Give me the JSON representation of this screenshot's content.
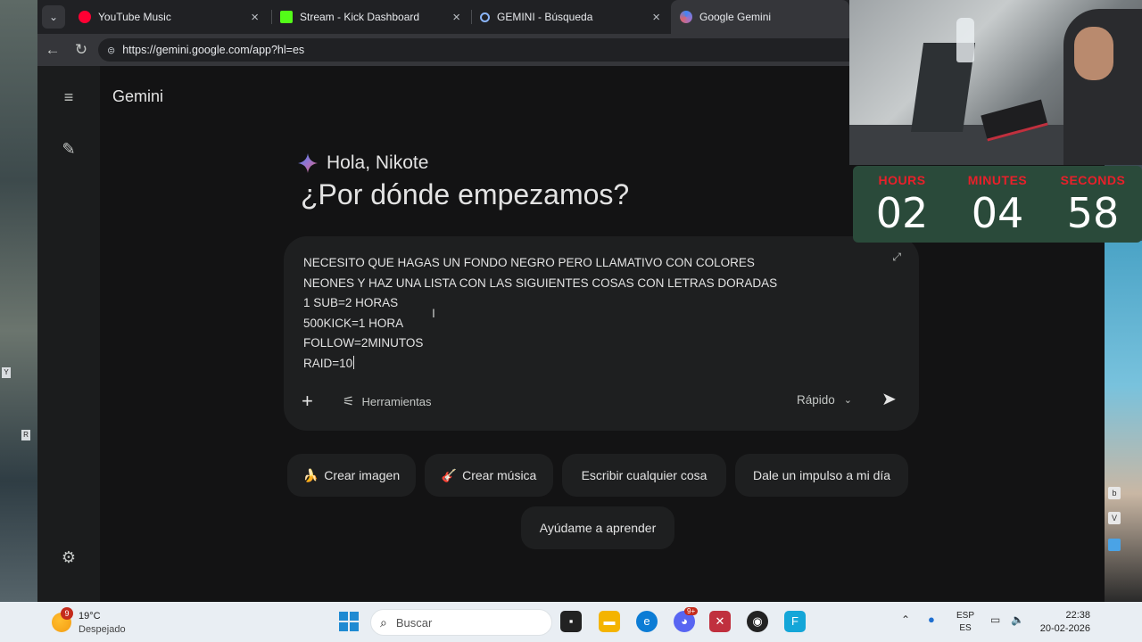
{
  "browser": {
    "tabs": [
      {
        "title": "YouTube Music",
        "favicon": "youtube-music-icon",
        "color": "#ff0033"
      },
      {
        "title": "Stream - Kick Dashboard",
        "favicon": "kick-icon",
        "color": "#53fc18"
      },
      {
        "title": "GEMINI - Búsqueda",
        "favicon": "search-icon",
        "color": "#8ab4f8"
      },
      {
        "title": "Google Gemini",
        "favicon": "gemini-icon",
        "color": "#4285f4"
      }
    ],
    "url": "https://gemini.google.com/app?hl=es"
  },
  "gemini": {
    "brand": "Gemini",
    "greeting": "Hola, Nikote",
    "question": "¿Por dónde empezamos?",
    "prompt_lines": [
      "NECESITO QUE HAGAS UN FONDO NEGRO PERO LLAMATIVO CON COLORES",
      "NEONES Y HAZ UNA LISTA CON LAS SIGUIENTES COSAS CON LETRAS DORADAS",
      "1 SUB=2 HORAS",
      "500KICK=1 HORA",
      "FOLLOW=2MINUTOS",
      "RAID=10"
    ],
    "tools_label": "Herramientas",
    "mode_label": "Rápido",
    "chips": [
      {
        "icon": "🍌",
        "label": "Crear imagen"
      },
      {
        "icon": "🎸",
        "label": "Crear música"
      },
      {
        "icon": "",
        "label": "Escribir cualquier cosa"
      },
      {
        "icon": "",
        "label": "Dale un impulso a mi día"
      },
      {
        "icon": "",
        "label": "Ayúdame a aprender"
      }
    ]
  },
  "timer": {
    "hours_label": "HOURS",
    "hours": "02",
    "minutes_label": "MINUTES",
    "minutes": "04",
    "seconds_label": "SECONDS",
    "seconds": "58",
    "label_color": "#e8202a"
  },
  "taskbar": {
    "weather_temp": "19°C",
    "weather_desc": "Despejado",
    "weather_badge": "9",
    "search_placeholder": "Buscar",
    "discord_badge": "9+",
    "lang_top": "ESP",
    "lang_bottom": "ES",
    "time": "22:38",
    "date": "20-02-2026"
  }
}
